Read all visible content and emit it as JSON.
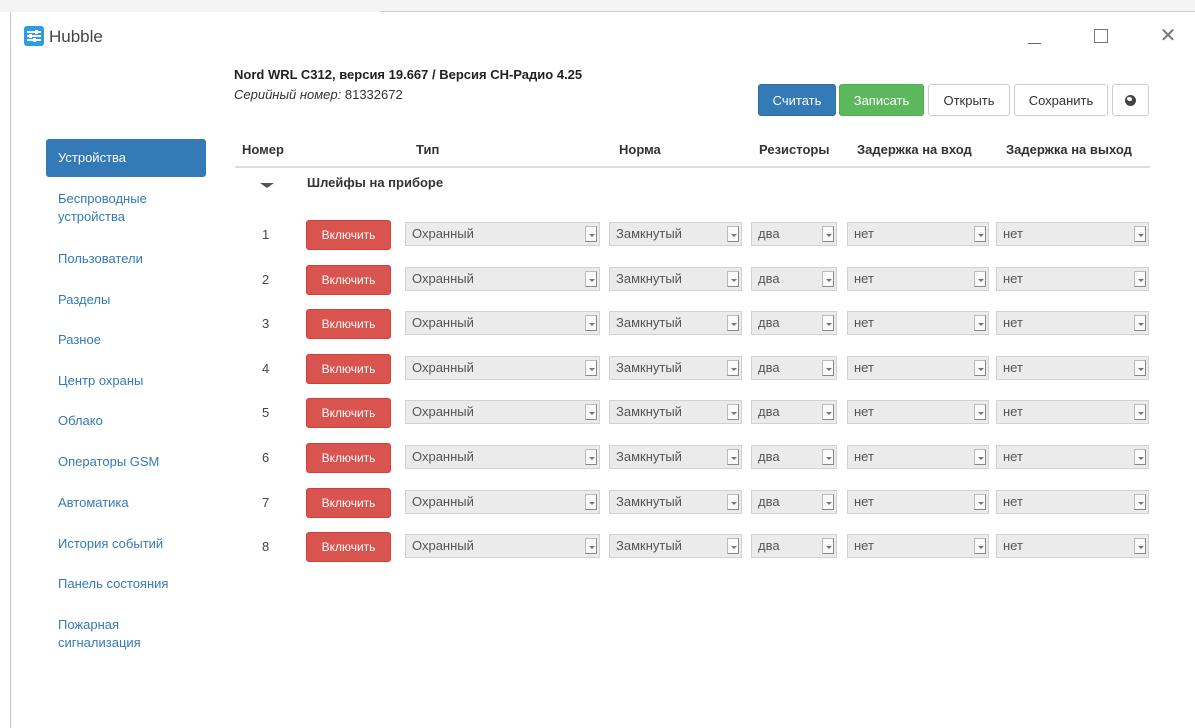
{
  "window": {
    "title": "Hubble",
    "controls": {
      "minimize_icon": "minimize-icon",
      "maximize_icon": "maximize-icon",
      "close_icon": "close-icon",
      "close_glyph": "✕"
    }
  },
  "device": {
    "title": "Nord WRL C312, версия 19.667 / Версия СН-Радио 4.25",
    "serial_label": "Серийный номер:",
    "serial_value": " 81332672"
  },
  "toolbar": {
    "read_label": "Считать",
    "write_label": "Записать",
    "open_label": "Открыть",
    "save_label": "Сохранить",
    "language_icon": "globe-icon"
  },
  "sidebar": {
    "items": [
      {
        "label": "Устройства",
        "active": true
      },
      {
        "label": "Беспроводные устройства"
      },
      {
        "label": "Пользователи"
      },
      {
        "label": "Разделы"
      },
      {
        "label": "Разное"
      },
      {
        "label": "Центр охраны"
      },
      {
        "label": "Облако"
      },
      {
        "label": "Операторы GSM"
      },
      {
        "label": "Автоматика"
      },
      {
        "label": "История событий"
      },
      {
        "label": "Панель состояния"
      },
      {
        "label": "Пожарная сигнализация"
      }
    ]
  },
  "table": {
    "headers": {
      "number": "Номер",
      "type": "Тип",
      "norm": "Норма",
      "resistors": "Резисторы",
      "entry_delay": "Задержка на вход",
      "exit_delay": "Задержка на выход"
    },
    "group_label": "Шлейфы на приборе",
    "rows": [
      {
        "num": "1",
        "button": "Включить",
        "type": "Охранный",
        "norm": "Замкнутый",
        "resistors": "два",
        "entry_delay": "нет",
        "exit_delay": "нет"
      },
      {
        "num": "2",
        "button": "Включить",
        "type": "Охранный",
        "norm": "Замкнутый",
        "resistors": "два",
        "entry_delay": "нет",
        "exit_delay": "нет"
      },
      {
        "num": "3",
        "button": "Включить",
        "type": "Охранный",
        "norm": "Замкнутый",
        "resistors": "два",
        "entry_delay": "нет",
        "exit_delay": "нет"
      },
      {
        "num": "4",
        "button": "Включить",
        "type": "Охранный",
        "norm": "Замкнутый",
        "resistors": "два",
        "entry_delay": "нет",
        "exit_delay": "нет"
      },
      {
        "num": "5",
        "button": "Включить",
        "type": "Охранный",
        "norm": "Замкнутый",
        "resistors": "два",
        "entry_delay": "нет",
        "exit_delay": "нет"
      },
      {
        "num": "6",
        "button": "Включить",
        "type": "Охранный",
        "norm": "Замкнутый",
        "resistors": "два",
        "entry_delay": "нет",
        "exit_delay": "нет"
      },
      {
        "num": "7",
        "button": "Включить",
        "type": "Охранный",
        "norm": "Замкнутый",
        "resistors": "два",
        "entry_delay": "нет",
        "exit_delay": "нет"
      },
      {
        "num": "8",
        "button": "Включить",
        "type": "Охранный",
        "norm": "Замкнутый",
        "resistors": "два",
        "entry_delay": "нет",
        "exit_delay": "нет"
      }
    ]
  },
  "colors": {
    "primary": "#337ab7",
    "success": "#5cb85c",
    "danger": "#d9534f",
    "select_bg": "#ebebeb"
  }
}
